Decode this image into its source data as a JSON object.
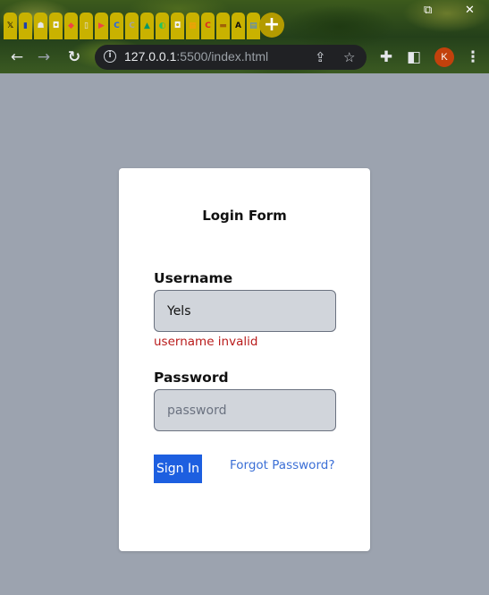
{
  "browser": {
    "tabs": [
      {
        "icon": "x-icon",
        "glyph": "𝕏",
        "color": "#111111"
      },
      {
        "icon": "doc-icon",
        "glyph": "▮",
        "color": "#1e40af"
      },
      {
        "icon": "flask-icon",
        "glyph": "☗",
        "color": "#e5e7eb"
      },
      {
        "icon": "cup-icon",
        "glyph": "◘",
        "color": "#f3f4f6"
      },
      {
        "icon": "shield-icon",
        "glyph": "◆",
        "color": "#ef4444"
      },
      {
        "icon": "bottle-icon",
        "glyph": "▯",
        "color": "#e5e7eb"
      },
      {
        "icon": "youtube-icon",
        "glyph": "▶",
        "color": "#ef4444"
      },
      {
        "icon": "c-icon",
        "glyph": "C",
        "color": "#2563eb"
      },
      {
        "icon": "c-icon",
        "glyph": "C",
        "color": "#a3a3a3"
      },
      {
        "icon": "arrow-icon",
        "glyph": "▲",
        "color": "#059669"
      },
      {
        "icon": "leaf-icon",
        "glyph": "◐",
        "color": "#22c55e"
      },
      {
        "icon": "cup-icon",
        "glyph": "◘",
        "color": "#f3f4f6"
      },
      {
        "icon": "image-icon",
        "glyph": "▦",
        "color": "#f59e0b"
      },
      {
        "icon": "c-icon",
        "glyph": "C",
        "color": "#dc2626"
      },
      {
        "icon": "folder-icon",
        "glyph": "▬",
        "color": "#a16207"
      },
      {
        "icon": "a-icon",
        "glyph": "A",
        "color": "#111111"
      },
      {
        "icon": "doc-icon",
        "glyph": "▤",
        "color": "#3b82f6"
      }
    ],
    "new_tab_label": "+",
    "url_host": "127.0.0.1",
    "url_rest": ":5500/index.html",
    "avatar_letter": "K"
  },
  "form": {
    "title": "Login Form",
    "username_label": "Username",
    "username_value": "Yels",
    "username_error": "username invalid",
    "password_label": "Password",
    "password_placeholder": "password",
    "signin_label": "Sign In",
    "forgot_label": "Forgot Password?"
  },
  "colors": {
    "page_background": "#9ca3af",
    "input_background": "#d1d5db",
    "button": "#1d5fe0",
    "error": "#b91c1c",
    "link": "#3b6fd6"
  }
}
